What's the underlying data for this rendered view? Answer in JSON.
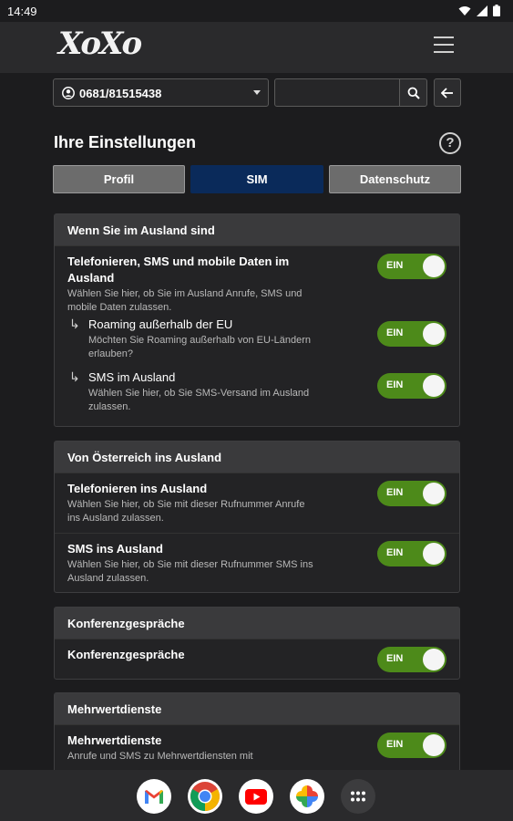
{
  "status": {
    "time": "14:49"
  },
  "header": {
    "logo": "XoXo"
  },
  "selector": {
    "number": "0681/81515438"
  },
  "search": {
    "placeholder": ""
  },
  "page": {
    "title": "Ihre Einstellungen",
    "help": "?"
  },
  "tabs": [
    {
      "label": "Profil"
    },
    {
      "label": "SIM"
    },
    {
      "label": "Datenschutz"
    }
  ],
  "sections": [
    {
      "title": "Wenn Sie im Ausland sind",
      "rows": [
        {
          "title": "Telefonieren, SMS und mobile Daten im Ausland",
          "desc": "Wählen Sie hier, ob Sie im Ausland Anrufe, SMS und mobile Daten zulassen.",
          "toggle": "EIN"
        },
        {
          "title": "Roaming außerhalb der EU",
          "desc": "Möchten Sie Roaming außerhalb von EU-Ländern erlauben?",
          "toggle": "EIN"
        },
        {
          "title": "SMS im Ausland",
          "desc": "Wählen Sie hier, ob Sie SMS-Versand im Ausland zulassen.",
          "toggle": "EIN"
        }
      ]
    },
    {
      "title": "Von Österreich ins Ausland",
      "rows": [
        {
          "title": "Telefonieren ins Ausland",
          "desc": "Wählen Sie hier, ob Sie mit dieser Rufnummer Anrufe ins Ausland zulassen.",
          "toggle": "EIN"
        },
        {
          "title": "SMS ins Ausland",
          "desc": "Wählen Sie hier, ob Sie mit dieser Rufnummer SMS ins Ausland zulassen.",
          "toggle": "EIN"
        }
      ]
    },
    {
      "title": "Konferenzgespräche",
      "rows": [
        {
          "title": "Konferenzgespräche",
          "desc": "",
          "toggle": "EIN"
        }
      ]
    },
    {
      "title": "Mehrwertdienste",
      "rows": [
        {
          "title": "Mehrwertdienste",
          "desc": "Anrufe und SMS zu Mehrwertdiensten mit",
          "toggle": "EIN"
        }
      ]
    }
  ],
  "dock": [
    "gmail-icon",
    "chrome-icon",
    "youtube-icon",
    "photos-icon",
    "app-drawer-icon"
  ],
  "colors": {
    "toggle_on": "#4d8a1a",
    "tab_active": "#0a2a5a",
    "background": "#1c1c1e"
  }
}
